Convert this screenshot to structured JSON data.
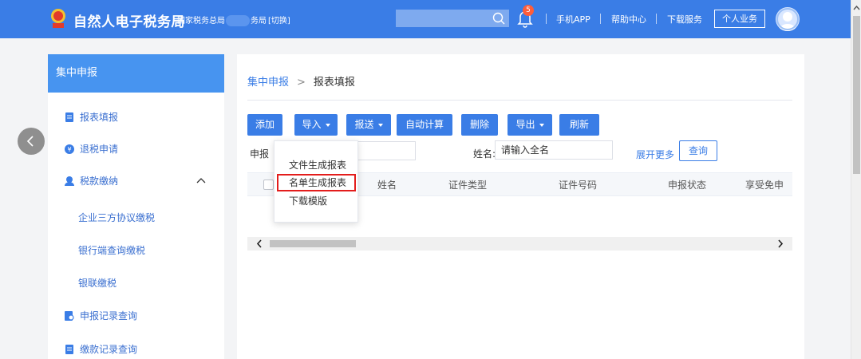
{
  "header": {
    "title": "自然人电子税务局",
    "subtitle_prefix": "国家税务总局",
    "subtitle_suffix": "务局",
    "switch_label": "[切换]",
    "notification_count": "5",
    "links": [
      "手机APP",
      "帮助中心",
      "下载服务"
    ],
    "personal_button": "个人业务",
    "brand_color": "#3a7de6"
  },
  "sidebar": {
    "heading": "集中申报",
    "items": [
      {
        "label": "报表填报",
        "icon": "document-icon"
      },
      {
        "label": "退税申请",
        "icon": "refund-icon"
      },
      {
        "label": "税款缴纳",
        "icon": "payment-icon"
      },
      {
        "label": "企业三方协议缴税"
      },
      {
        "label": "银行端查询缴税"
      },
      {
        "label": "银联缴税"
      },
      {
        "label": "申报记录查询",
        "icon": "record-search-icon"
      },
      {
        "label": "缴款记录查询",
        "icon": "payment-record-icon"
      }
    ]
  },
  "main": {
    "breadcrumb": {
      "root": "集中申报",
      "current": "报表填报"
    },
    "toolbar": {
      "add": "添加",
      "import": "导入",
      "submit": "报送",
      "auto_calc": "自动计算",
      "delete": "删除",
      "export": "导出",
      "refresh": "刷新"
    },
    "filters": {
      "status_label": "申报",
      "name_label": "姓名:",
      "name_value": "请输入全名",
      "expand_more": "展开更多",
      "query": "查询"
    },
    "table": {
      "columns": [
        "姓名",
        "证件类型",
        "证件号码",
        "申报状态",
        "享受免申"
      ]
    },
    "import_menu": {
      "items": [
        "文件生成报表",
        "名单生成报表",
        "下载模版"
      ],
      "highlighted_index": 1
    }
  }
}
